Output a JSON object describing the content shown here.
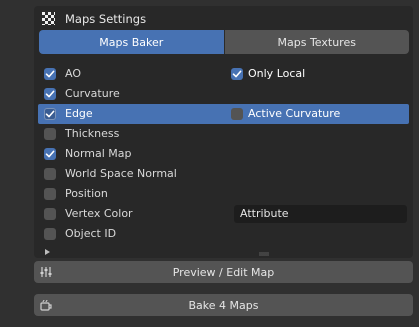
{
  "panel": {
    "title": "Maps Settings",
    "header_icon": "checker-icon"
  },
  "tabs": [
    {
      "label": "Maps Baker",
      "active": true
    },
    {
      "label": "Maps Textures",
      "active": false
    }
  ],
  "maps": [
    {
      "label": "AO",
      "checked": true
    },
    {
      "label": "Curvature",
      "checked": true
    },
    {
      "label": "Edge",
      "checked": true,
      "highlighted": true
    },
    {
      "label": "Thickness",
      "checked": false
    },
    {
      "label": "Normal Map",
      "checked": true
    },
    {
      "label": "World Space Normal",
      "checked": false
    },
    {
      "label": "Position",
      "checked": false
    },
    {
      "label": "Vertex Color",
      "checked": false
    },
    {
      "label": "Object ID",
      "checked": false
    }
  ],
  "options": {
    "only_local": {
      "label": "Only Local",
      "checked": true
    },
    "active_curvature": {
      "label": "Active Curvature",
      "checked": false
    }
  },
  "vertex_color_field": {
    "value": "Attribute"
  },
  "buttons": {
    "preview": {
      "label": "Preview / Edit Map",
      "icon": "sliders-icon"
    },
    "bake": {
      "label": "Bake 4 Maps",
      "icon": "bake-icon"
    }
  },
  "colors": {
    "accent": "#4772b3",
    "panel_bg": "#282828",
    "window_bg": "#303030",
    "button_bg": "#545454"
  }
}
